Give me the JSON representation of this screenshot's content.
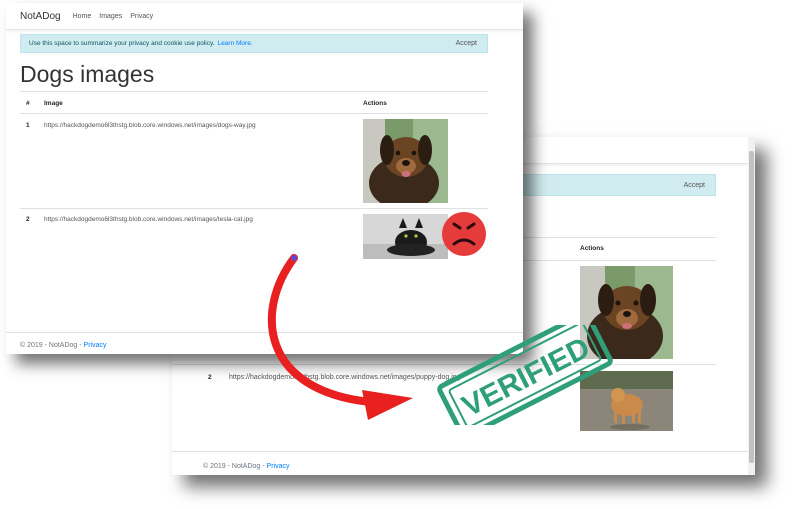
{
  "front": {
    "brand": "NotADog",
    "nav": [
      "Home",
      "Images",
      "Privacy"
    ],
    "cookie_text": "Use this space to summarize your privacy and cookie use policy.",
    "cookie_link": "Learn More.",
    "cookie_accept": "Accept",
    "page_title": "Dogs images",
    "headers": {
      "num": "#",
      "image": "Image",
      "actions": "Actions"
    },
    "rows": [
      {
        "num": "1",
        "url": "https://hackdogdemo6l3thstg.blob.core.windows.net/images/dogs-way.jpg"
      },
      {
        "num": "2",
        "url": "https://hackdogdemo6l3thstg.blob.core.windows.net/images/tesla-cat.jpg"
      }
    ],
    "footer_text": "© 2019 - NotADog -",
    "footer_link": "Privacy"
  },
  "back": {
    "cookie_accept": "Accept",
    "headers": {
      "actions": "Actions"
    },
    "rows": [
      {
        "num": "2",
        "url": "https://hackdogdemo6l3thstg.blob.core.windows.net/images/puppy-dog.jpg"
      }
    ],
    "footer_text": "© 2019 - NotADog -",
    "footer_link": "Privacy"
  },
  "stamp": {
    "text": "VERIFIED",
    "color": "#2e9f7a"
  },
  "accents": {
    "arrow": "#e82020",
    "sad_face": "#e53b3b",
    "link": "#007bff"
  },
  "icons": [
    "sad-face-icon",
    "curved-arrow-icon",
    "verified-stamp-icon"
  ]
}
